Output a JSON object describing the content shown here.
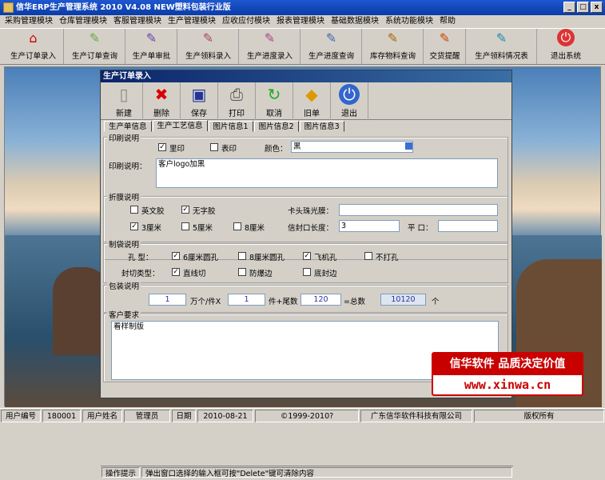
{
  "window": {
    "title": "信华ERP生产管理系统  2010 V4.08 NEW塑料包装行业版",
    "min": "_",
    "max": "□",
    "close": "x"
  },
  "menu": [
    "采购管理模块",
    "仓库管理模块",
    "客服管理模块",
    "生产管理模块",
    "应收应付模块",
    "报表管理模块",
    "基础数据模块",
    "系统功能模块",
    "帮助"
  ],
  "toolbar": [
    "生产订单录入",
    "生产订单查询",
    "生产单审批",
    "生产领料录入",
    "生产进度录入",
    "生产进度查询",
    "库存物料查询",
    "交货提醒",
    "生产领料情况表",
    "退出系统"
  ],
  "child": {
    "title": "生产订单录入",
    "tools": [
      "新建",
      "删除",
      "保存",
      "打印",
      "取消",
      "旧单",
      "退出"
    ],
    "tabs": [
      "生产单信息",
      "生产工艺信息",
      "图片信息1",
      "图片信息2",
      "图片信息3"
    ],
    "print": {
      "group": "印刷说明",
      "inner": "里印",
      "outer": "表印",
      "color_label": "颜色：",
      "color_value": "黑",
      "desc_label": "印刷说明：",
      "desc_value": "客户logo加黑"
    },
    "fold": {
      "group": "折膜说明",
      "a": "英文胶",
      "b": "无字胶",
      "c": "3厘米",
      "d": "5厘米",
      "e": "8厘米",
      "tape_label": "卡头珠光膜：",
      "tape_value": "",
      "len_label": "信封口长度：",
      "len_value": "3",
      "mouth_label": "平 口：",
      "mouth_value": ""
    },
    "bag": {
      "group": "制袋说明",
      "hole_label": "孔 型：",
      "h1": "6厘米圆孔",
      "h2": "8厘米圆孔",
      "h3": "飞机孔",
      "h4": "不打孔",
      "seal_label": "封切类型：",
      "s1": "直线切",
      "s2": "防爆边",
      "s3": "底封边"
    },
    "pack": {
      "group": "包装说明",
      "v1": "1",
      "t1": "万个/件X",
      "v2": "1",
      "t2": "件+尾数",
      "v3": "120",
      "t3": "=总数",
      "v4": "10120",
      "t4": "个"
    },
    "customer": {
      "group": "客户要求",
      "value": "看样制版"
    },
    "hint_label": "操作提示",
    "hint_text": "弹出窗口选择的输入框可按\"Delete\"键可清除内容"
  },
  "status": {
    "user_no_label": "用户编号",
    "user_no": "180001",
    "user_name_label": "用户姓名",
    "user_name": "管理员",
    "date_label": "日期",
    "date": "2010-08-21",
    "copyright": "©1999-2010?",
    "company": "广东信华软件科技有限公司",
    "rights": "版权所有"
  },
  "stamp": {
    "line1": "信华软件 品质决定价值",
    "line2": "www.xinwa.cn"
  }
}
